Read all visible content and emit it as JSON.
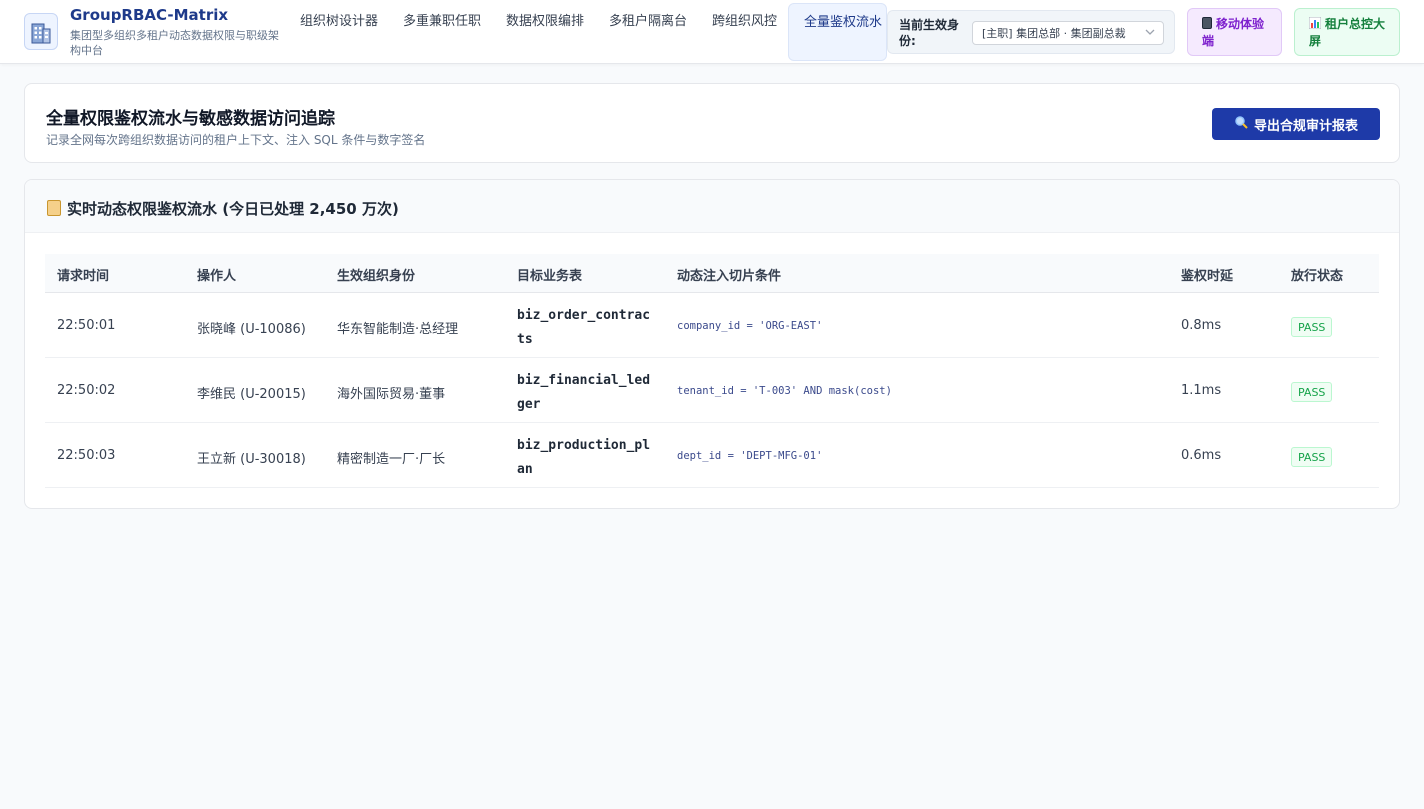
{
  "app": {
    "title": "GroupRBAC-Matrix",
    "subtitle": "集团型多组织多租户动态数据权限与职级架构中台"
  },
  "nav": {
    "items": [
      {
        "label": "组织树设计器"
      },
      {
        "label": "多重兼职任职"
      },
      {
        "label": "数据权限编排"
      },
      {
        "label": "多租户隔离台"
      },
      {
        "label": "跨组织风控"
      },
      {
        "label": "全量鉴权流水"
      }
    ],
    "active_index": 5
  },
  "identity": {
    "label": "当前生效身份:",
    "value": "[主职] 集团总部 · 集团副总裁"
  },
  "header_buttons": {
    "mobile": "移动体验端",
    "screen": "租户总控大屏"
  },
  "page": {
    "title": "全量权限鉴权流水与敏感数据访问追踪",
    "subtitle": "记录全网每次跨组织数据访问的租户上下文、注入 SQL 条件与数字签名",
    "export_label": "导出合规审计报表"
  },
  "flow": {
    "title": "实时动态权限鉴权流水 (今日已处理 2,450 万次)",
    "columns": [
      "请求时间",
      "操作人",
      "生效组织身份",
      "目标业务表",
      "动态注入切片条件",
      "鉴权时延",
      "放行状态"
    ],
    "rows": [
      {
        "time": "22:50:01",
        "operator": "张晓峰 (U-10086)",
        "org": "华东智能制造·总经理",
        "table": "biz_order_contracts",
        "condition": "company_id = 'ORG-EAST'",
        "latency": "0.8ms",
        "status": "PASS"
      },
      {
        "time": "22:50:02",
        "operator": "李维民 (U-20015)",
        "org": "海外国际贸易·董事",
        "table": "biz_financial_ledger",
        "condition": "tenant_id = 'T-003' AND mask(cost)",
        "latency": "1.1ms",
        "status": "PASS"
      },
      {
        "time": "22:50:03",
        "operator": "王立新 (U-30018)",
        "org": "精密制造一厂·厂长",
        "table": "biz_production_plan",
        "condition": "dept_id = 'DEPT-MFG-01'",
        "latency": "0.6ms",
        "status": "PASS"
      }
    ]
  },
  "colors": {
    "brand": "#1e3a8a",
    "primary_button": "#1e3aa8",
    "pass": "#16a34a",
    "mobile_accent": "#7e22ce",
    "screen_accent": "#15803d"
  },
  "icons": {
    "logo": "building-icon",
    "mobile": "phone-icon",
    "screen": "bar-chart-icon",
    "export": "magnifier-icon",
    "flow": "scroll-icon",
    "select": "chevron-down-icon"
  }
}
